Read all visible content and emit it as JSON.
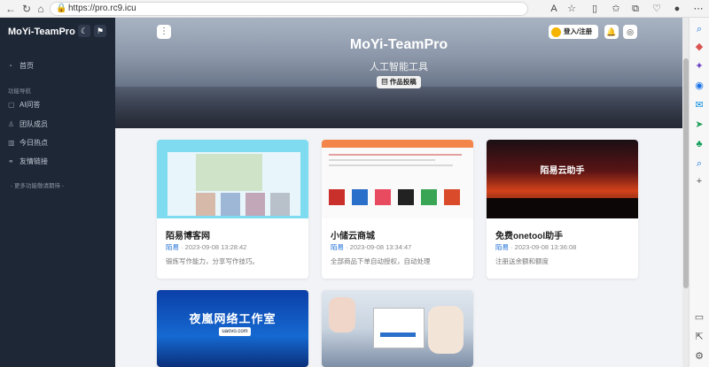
{
  "browser": {
    "url": "https://pro.rc9.icu"
  },
  "sidebar": {
    "brand": "MoYi-TeamPro",
    "home": "首页",
    "section": "功能导航",
    "items": [
      {
        "label": "AI问答",
        "icon": "chat-icon"
      },
      {
        "label": "团队成员",
        "icon": "user-icon"
      },
      {
        "label": "今日热点",
        "icon": "chart-icon"
      },
      {
        "label": "友情链接",
        "icon": "link-icon"
      }
    ],
    "more": "- 更多功能敬请期待 -"
  },
  "hero": {
    "title": "MoYi-TeamPro",
    "subtitle": "人工智能工具",
    "submit_label": "作品投稿",
    "login_label": "登入/注册"
  },
  "cards": [
    {
      "title": "陌易博客网",
      "author": "陌易",
      "date": "2023-09-08 13:28:42",
      "desc": "锻炼写作能力，分享写作技巧。"
    },
    {
      "title": "小储云商城",
      "author": "陌易",
      "date": "2023-09-08 13:34:47",
      "desc": "全部商品下单自动授权，自动处理"
    },
    {
      "title": "免费onetool助手",
      "author": "陌易",
      "date": "2023-09-08 13:36:08",
      "desc": "注册送余额和额度",
      "image_text": "陌易云助手"
    },
    {
      "title": "",
      "image_text": "夜嵐网络工作室",
      "image_sub": "uaovo.com"
    },
    {
      "title": ""
    }
  ],
  "colors": {
    "sidebar_bg": "#1e2736",
    "accent": "#1f6fd6",
    "page_bg": "#f1f3f6"
  }
}
